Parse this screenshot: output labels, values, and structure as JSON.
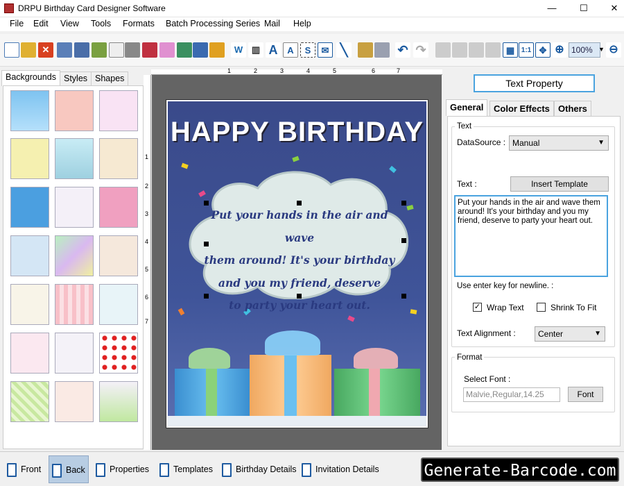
{
  "app": {
    "title": "DRPU Birthday Card Designer Software"
  },
  "window_buttons": {
    "minimize": "—",
    "maximize": "☐",
    "close": "✕"
  },
  "menu": [
    "File",
    "Edit",
    "View",
    "Tools",
    "Formats",
    "Batch Processing Series",
    "Mail",
    "Help"
  ],
  "toolbar": {
    "zoom": "100%"
  },
  "left_tabs": [
    "Backgrounds",
    "Styles",
    "Shapes"
  ],
  "card": {
    "title": "HAPPY BIRTHDAY",
    "message_lines": [
      "Put your hands in the air and wave",
      "them around! It's your birthday",
      "and you my friend, deserve",
      "to party your heart out."
    ]
  },
  "ruler_numbers": [
    "1",
    "2",
    "3",
    "4",
    "5",
    "6",
    "7"
  ],
  "right_panel": {
    "header": "Text Property",
    "tabs": [
      "General",
      "Color Effects",
      "Others"
    ],
    "text_group": "Text",
    "datasource_label": "DataSource :",
    "datasource_value": "Manual",
    "text_label": "Text :",
    "insert_template": "Insert Template",
    "text_value": "Put your hands in the air and wave them around! It's your birthday and you my friend, deserve to party your heart out.",
    "newline_hint": "Use enter key for newline. :",
    "wrap_text": "Wrap Text",
    "wrap_checked": true,
    "shrink_to_fit": "Shrink To Fit",
    "shrink_checked": false,
    "alignment_label": "Text Alignment :",
    "alignment_value": "Center",
    "format_group": "Format",
    "select_font_label": "Select Font :",
    "font_value": "Malvie,Regular,14.25",
    "font_button": "Font"
  },
  "bottom_bar": [
    "Front",
    "Back",
    "Properties",
    "Templates",
    "Birthday Details",
    "Invitation Details"
  ],
  "brand": "Generate-Barcode.com",
  "colors": {
    "accent": "#4aa3df",
    "card_bg": "#3f5499",
    "card_text": "#2a3a80"
  }
}
